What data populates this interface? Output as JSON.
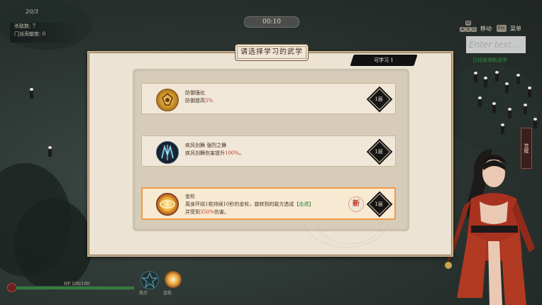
{
  "hud": {
    "level_tag": "20/3",
    "timer": "00:10",
    "stats": [
      "杀敌数: 7",
      "门派贡献度: 0"
    ],
    "controls": [
      {
        "keys": [
          "W",
          "A",
          "S",
          "D"
        ],
        "label": "移动"
      },
      {
        "keys": [
          "Esc"
        ],
        "label": "菜单"
      }
    ],
    "chat_placeholder": "Enter text...",
    "green_message": "已经获得新武学",
    "banner": "觉醒",
    "hp_text": "HP 100/100",
    "hp_fraction": 1.0,
    "skills": [
      {
        "label": "风刃",
        "icon": "star-icon"
      },
      {
        "label": "金轮",
        "icon": "golden-wheel-icon"
      }
    ]
  },
  "dialog": {
    "title": "请选择学习的武学",
    "tag": "可学习 1",
    "options": [
      {
        "icon": "defense-emblem-icon",
        "name": "防御强化",
        "desc_prefix": "防御提高",
        "desc_value": "5%",
        "desc_suffix": "",
        "extra": "",
        "level": "1层",
        "is_new": false,
        "selected": false
      },
      {
        "icon": "wind-sword-icon",
        "name": "疾风剑舞 强烈之舞",
        "desc_prefix": "疾风剑舞伤害提升",
        "desc_value": "100%",
        "desc_suffix": "。",
        "extra": "",
        "level": "1层",
        "is_new": false,
        "selected": false
      },
      {
        "icon": "golden-wheel-icon",
        "name": "金轮",
        "desc_prefix": "周身环绕1枚持续10秒的金轮，旋转到的敌方造成",
        "desc_tag": "【击退】",
        "line2_prefix": "并受到",
        "line2_value": "350%",
        "line2_suffix": "伤害。",
        "level": "1层",
        "is_new": true,
        "new_label": "新",
        "selected": true
      }
    ]
  }
}
